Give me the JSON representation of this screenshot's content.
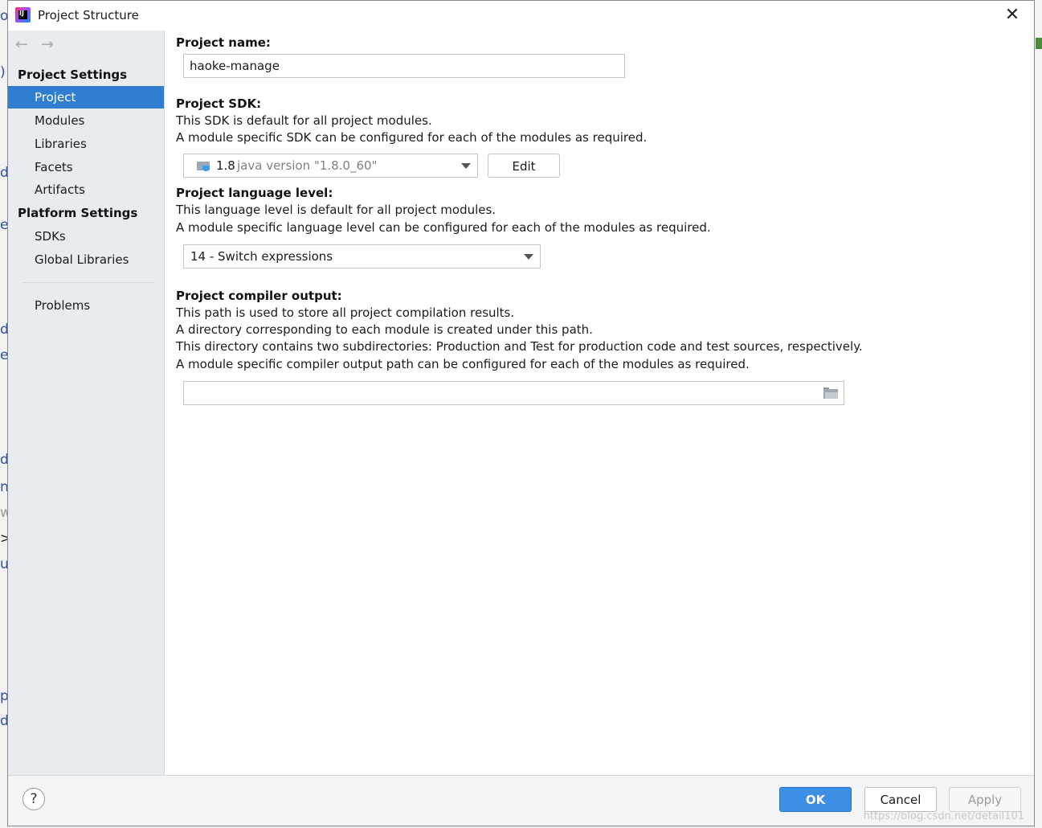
{
  "window": {
    "title": "Project Structure",
    "close_glyph": "✕"
  },
  "nav": {
    "back_glyph": "←",
    "forward_glyph": "→"
  },
  "sidebar": {
    "project_settings_heading": "Project Settings",
    "project_items": [
      "Project",
      "Modules",
      "Libraries",
      "Facets",
      "Artifacts"
    ],
    "platform_settings_heading": "Platform Settings",
    "platform_items": [
      "SDKs",
      "Global Libraries"
    ],
    "problems": "Problems",
    "selected": "Project"
  },
  "main": {
    "project_name_label": "Project name:",
    "project_name_value": "haoke-manage",
    "sdk_label": "Project SDK:",
    "sdk_desc_1": "This SDK is default for all project modules.",
    "sdk_desc_2": "A module specific SDK can be configured for each of the modules as required.",
    "sdk_version": "1.8",
    "sdk_detail": "java version \"1.8.0_60\"",
    "edit_button": "Edit",
    "lang_label": "Project language level:",
    "lang_desc_1": "This language level is default for all project modules.",
    "lang_desc_2": "A module specific language level can be configured for each of the modules as required.",
    "lang_value": "14 - Switch expressions",
    "output_label": "Project compiler output:",
    "output_desc_1": "This path is used to store all project compilation results.",
    "output_desc_2": "A directory corresponding to each module is created under this path.",
    "output_desc_3": "This directory contains two subdirectories: Production and Test for production code and test sources, respectively.",
    "output_desc_4": "A module specific compiler output path can be configured for each of the modules as required.",
    "output_value": ""
  },
  "bottom": {
    "help_glyph": "?",
    "ok": "OK",
    "cancel": "Cancel",
    "apply": "Apply",
    "watermark": "https://blog.csdn.net/detail101"
  },
  "background": {
    "chars": [
      "o",
      ")",
      "d",
      "e",
      "d",
      "e",
      "d",
      "n",
      "w",
      ">",
      "u",
      "p",
      "d"
    ]
  },
  "colors": {
    "selection": "#2f7ed1",
    "ok_button": "#3d8ee5",
    "sidebar_bg": "#e8ebef"
  }
}
